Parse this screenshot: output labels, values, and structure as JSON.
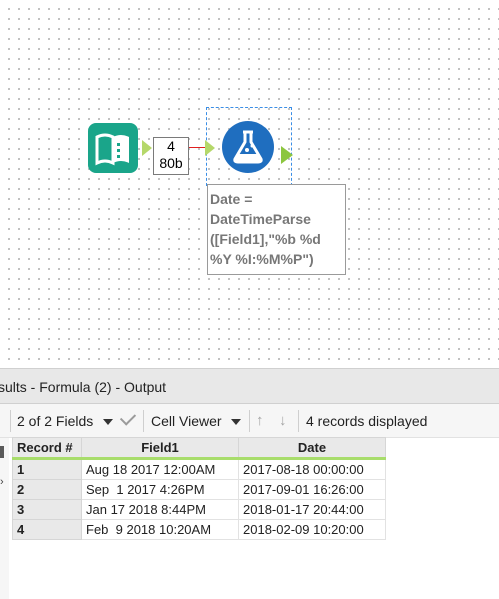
{
  "canvas": {
    "connection_label_count": "4",
    "connection_label_size": "80b",
    "annotation_text": "Date =\nDateTimeParse\n([Field1],\"%b %d\n%Y %I:%M%P\")",
    "icons": {
      "input": "book-icon",
      "formula": "flask-icon"
    },
    "colors": {
      "input_tool": "#1aa58a",
      "formula_tool": "#1f6ebf",
      "connection": "#e02020",
      "anchor": "#b5d86a"
    }
  },
  "results": {
    "title": "sults - Formula (2) - Output",
    "fields_selector": "2 of 2 Fields",
    "viewer_selector": "Cell Viewer",
    "records_displayed": "4 records displayed",
    "columns": [
      "Record #",
      "Field1",
      "Date"
    ],
    "rows": [
      {
        "record": "1",
        "field1": "Aug 18 2017 12:00AM",
        "date": "2017-08-18 00:00:00"
      },
      {
        "record": "2",
        "field1": "Sep  1 2017 4:26PM",
        "date": "2017-09-01 16:26:00"
      },
      {
        "record": "3",
        "field1": "Jan 17 2018 8:44PM",
        "date": "2018-01-17 20:44:00"
      },
      {
        "record": "4",
        "field1": "Feb  9 2018 10:20AM",
        "date": "2018-02-09 10:20:00"
      }
    ]
  }
}
